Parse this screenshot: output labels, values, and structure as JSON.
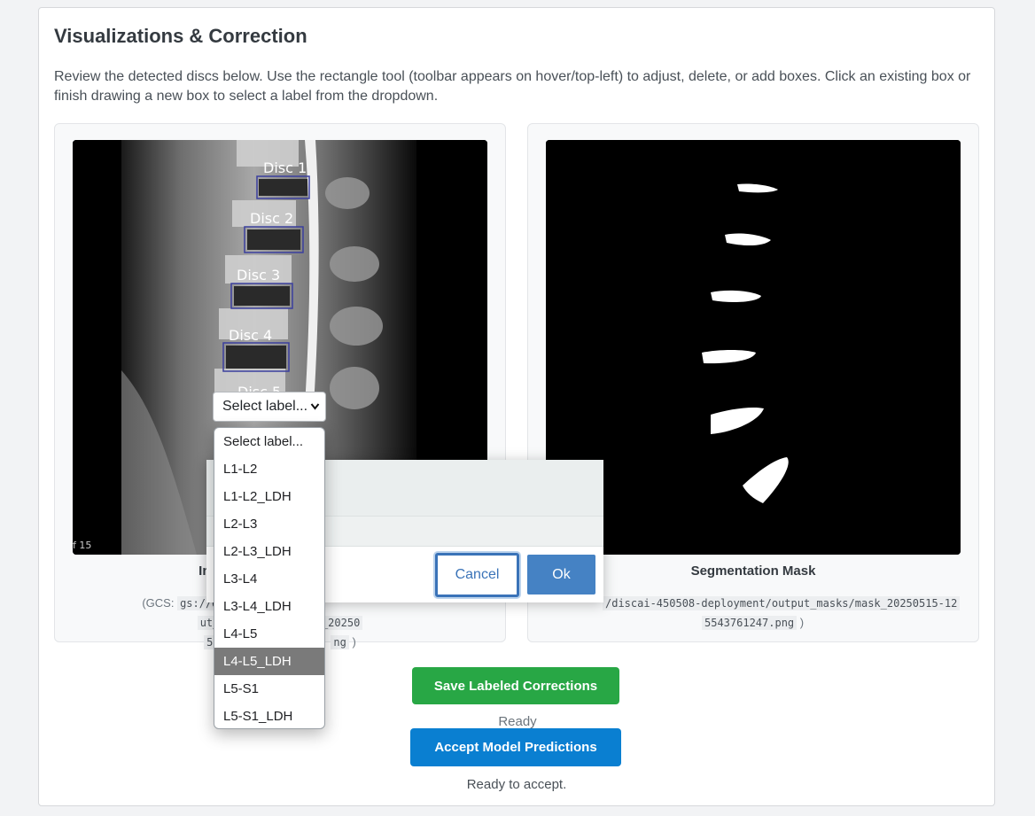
{
  "section": {
    "title": "Visualizations & Correction",
    "description": "Review the detected discs below. Use the rectangle tool (toolbar appears on hover/top-left) to adjust, delete, or add boxes. Click an existing box or finish drawing a new box to select a label from the dropdown."
  },
  "left_panel": {
    "caption": "Inpu",
    "gcs_prefix": "(GCS: ",
    "gcs_path_part1": "gs://discai-4505",
    "gcs_path_part1b": "ut_overlays/overlay_20250",
    "gcs_path_part2": "5",
    "gcs_path_part2b": "ng",
    "gcs_suffix": " )",
    "slice_label": "f 15",
    "disc_labels": [
      "Disc 1",
      "Disc 2",
      "Disc 3",
      "Disc 4",
      "Disc 5"
    ]
  },
  "right_panel": {
    "caption": "Segmentation Mask",
    "gcs_path_part1": "/discai-450508-deployment/output_masks/mask_20250515-12",
    "gcs_path_part2": "5543761247.png",
    "gcs_suffix": " )"
  },
  "dialog": {
    "cancel_label": "Cancel",
    "ok_label": "Ok"
  },
  "label_select": {
    "value": "Select label...",
    "options": [
      "Select label...",
      "L1-L2",
      "L1-L2_LDH",
      "L2-L3",
      "L2-L3_LDH",
      "L3-L4",
      "L3-L4_LDH",
      "L4-L5",
      "L4-L5_LDH",
      "L5-S1",
      "L5-S1_LDH"
    ],
    "highlighted": "L4-L5_LDH"
  },
  "actions": {
    "save_label": "Save Labeled Corrections",
    "save_status": "Ready",
    "accept_label": "Accept Model Predictions",
    "accept_status": "Ready to accept."
  },
  "colors": {
    "save_button": "#28a745",
    "accept_button": "#0a7fd1",
    "ok_button": "#4582c4",
    "box_stroke": "#3b3f9e"
  }
}
